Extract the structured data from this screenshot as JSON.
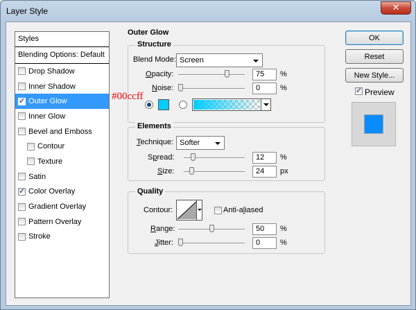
{
  "window": {
    "title": "Layer Style"
  },
  "styles_panel": {
    "header": "Styles",
    "blending": "Blending Options: Default",
    "items": [
      {
        "label": "Drop Shadow",
        "checked": false
      },
      {
        "label": "Inner Shadow",
        "checked": false
      },
      {
        "label": "Outer Glow",
        "checked": true,
        "selected": true
      },
      {
        "label": "Inner Glow",
        "checked": false
      },
      {
        "label": "Bevel and Emboss",
        "checked": false
      },
      {
        "label": "Contour",
        "checked": false,
        "sub": true
      },
      {
        "label": "Texture",
        "checked": false,
        "sub": true
      },
      {
        "label": "Satin",
        "checked": false
      },
      {
        "label": "Color Overlay",
        "checked": true
      },
      {
        "label": "Gradient Overlay",
        "checked": false
      },
      {
        "label": "Pattern Overlay",
        "checked": false
      },
      {
        "label": "Stroke",
        "checked": false
      }
    ]
  },
  "outer_glow": {
    "title": "Outer Glow",
    "structure": {
      "title": "Structure",
      "blend_mode_label": "Blend Mode:",
      "blend_mode_value": "Screen",
      "opacity_label": "Opacity:",
      "opacity_value": "75",
      "opacity_unit": "%",
      "opacity_level": 0.75,
      "noise_label": "Noise:",
      "noise_value": "0",
      "noise_unit": "%",
      "noise_level": 0.0,
      "color_annotation": "#00ccff",
      "glow_color": "#00ccff"
    },
    "elements": {
      "title": "Elements",
      "technique_label": "Technique:",
      "technique_value": "Softer",
      "spread_label": "Spread:",
      "spread_value": "12",
      "spread_unit": "%",
      "spread_level": 0.12,
      "size_label": "Size:",
      "size_value": "24",
      "size_unit": "px",
      "size_level": 0.1
    },
    "quality": {
      "title": "Quality",
      "contour_label": "Contour:",
      "anti_aliased_label": "Anti-aliased",
      "anti_aliased": false,
      "range_label": "Range:",
      "range_value": "50",
      "range_unit": "%",
      "range_level": 0.5,
      "jitter_label": "Jitter:",
      "jitter_value": "0",
      "jitter_unit": "%",
      "jitter_level": 0.0
    }
  },
  "buttons": {
    "ok": "OK",
    "reset": "Reset",
    "new_style": "New Style...",
    "preview_label": "Preview",
    "preview_checked": true
  },
  "colors": {
    "accent": "#3399ff",
    "preview_swatch": "#0a8cff",
    "close": "#c94c3a"
  }
}
